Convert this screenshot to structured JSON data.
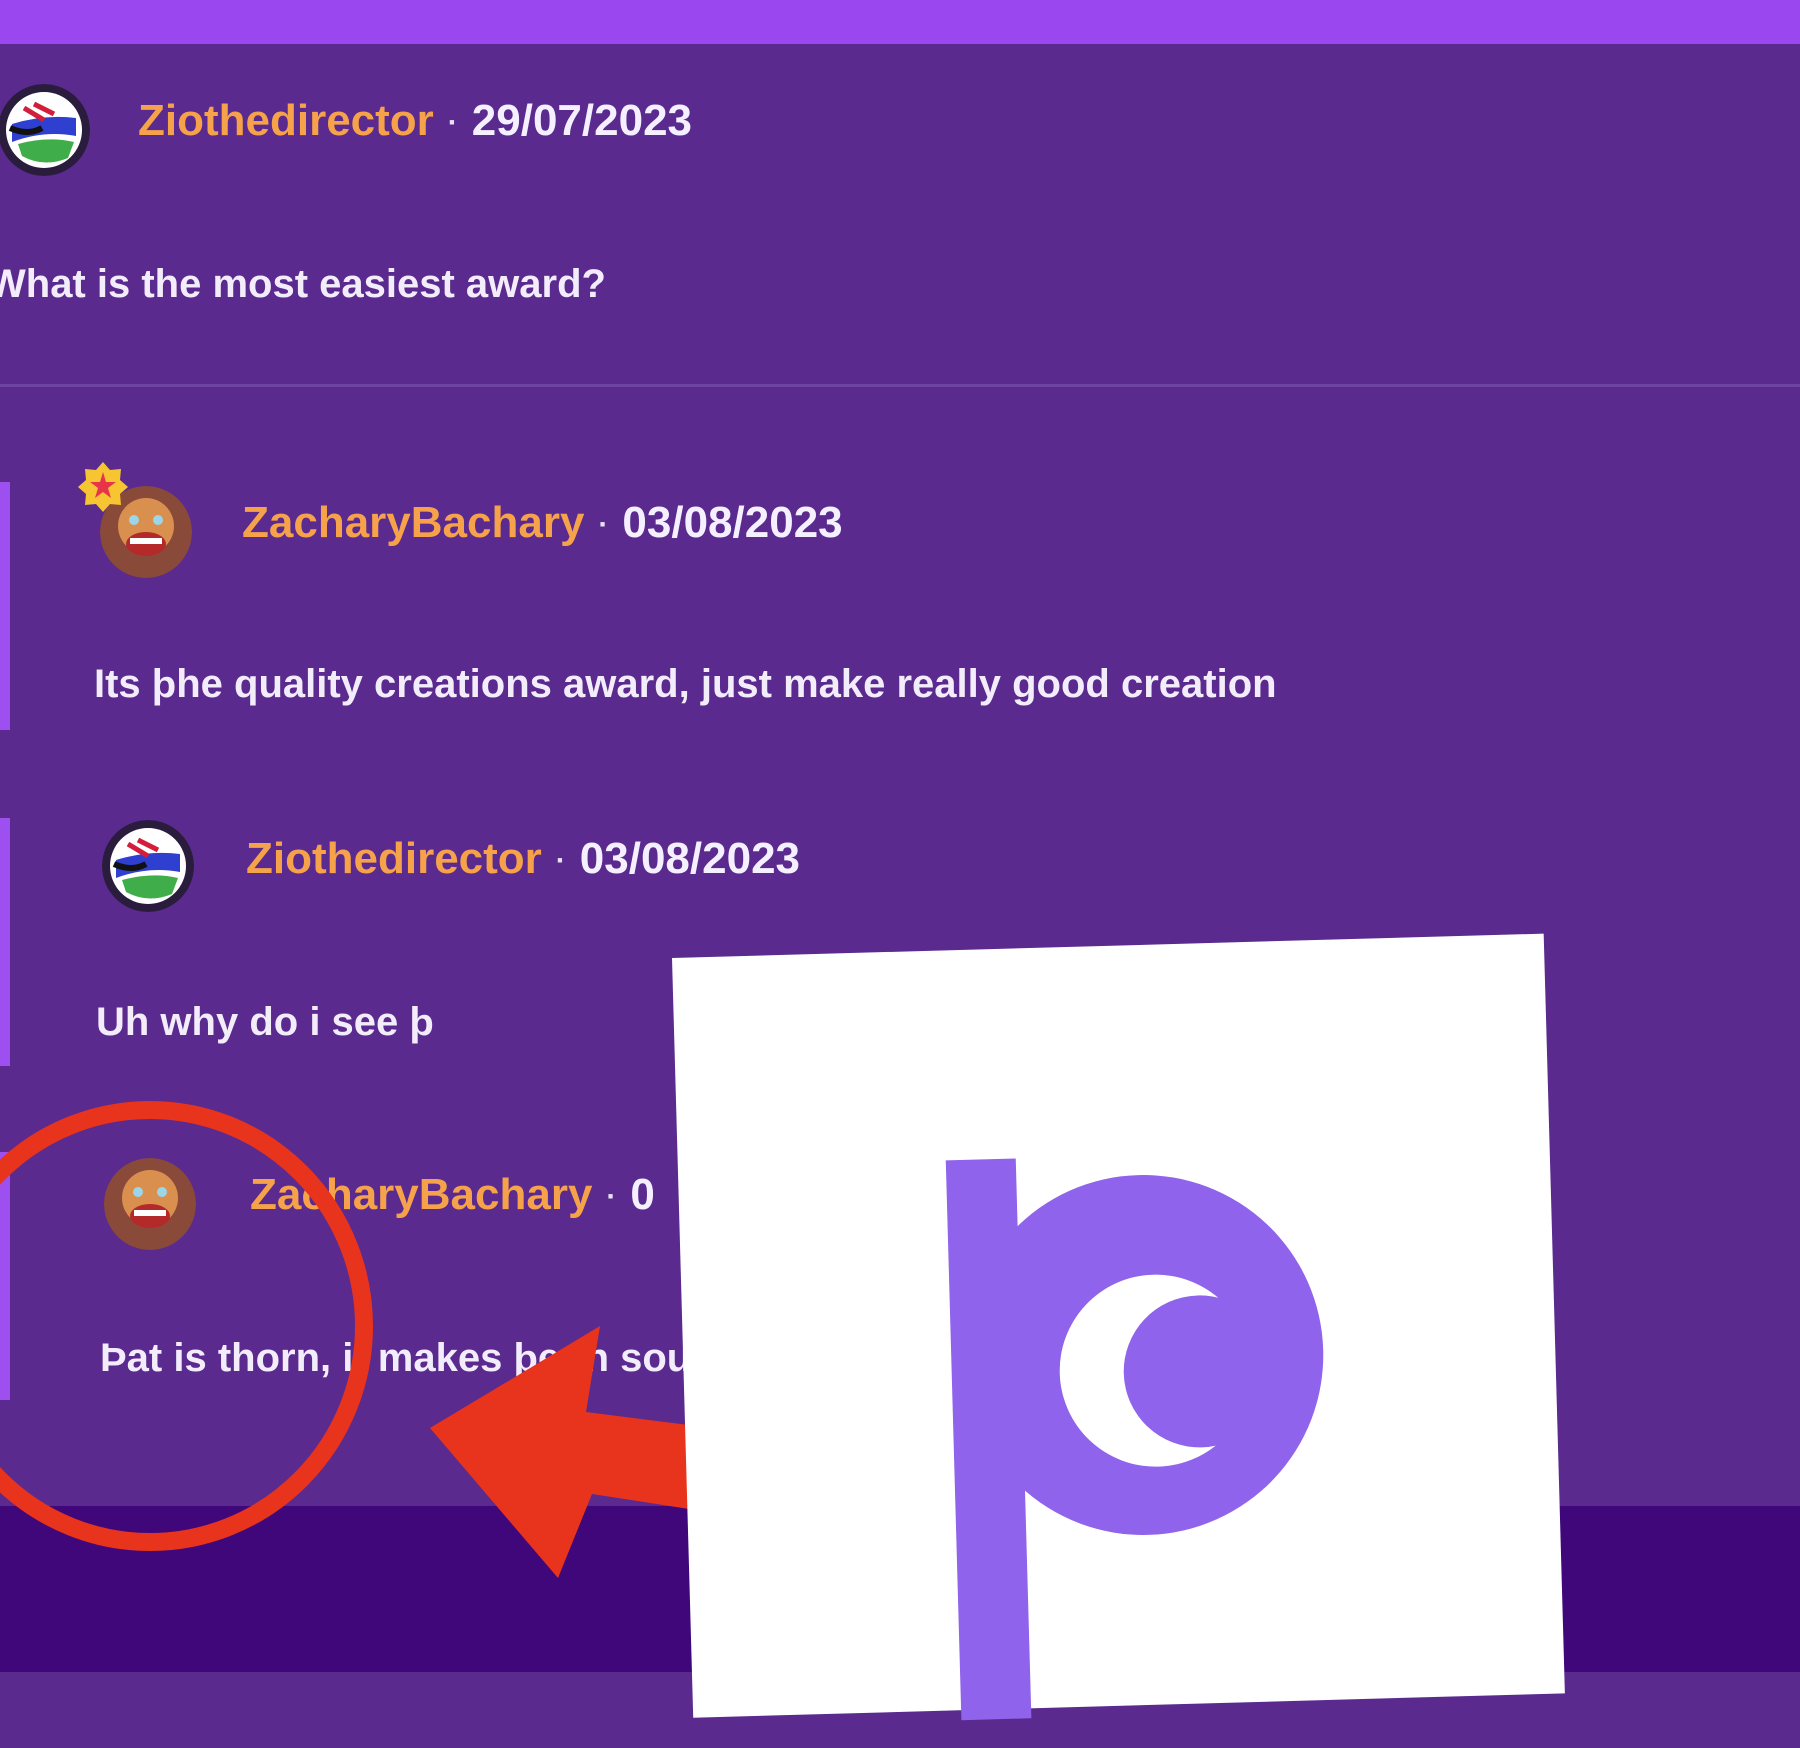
{
  "comments": [
    {
      "username": "Ziothedirector",
      "date": "29/07/2023",
      "text": "What is the most easiest award?"
    },
    {
      "username": "ZacharyBachary",
      "date": "03/08/2023",
      "text": "Its þhe quality creations award, just make really good creation"
    },
    {
      "username": "Ziothedirector",
      "date": "03/08/2023",
      "text": "Uh why do i see þ"
    },
    {
      "username": "ZacharyBachary",
      "date": "0",
      "text": "Þat is thorn, it makes þe th sound"
    }
  ],
  "separator": "·",
  "overlay": {
    "glyph": "þ"
  },
  "colors": {
    "accent": "#9b47ef",
    "panel": "#5a2a8e",
    "username": "#f6a24a",
    "annotation": "#e8341c",
    "thorn": "#8f63ec"
  }
}
